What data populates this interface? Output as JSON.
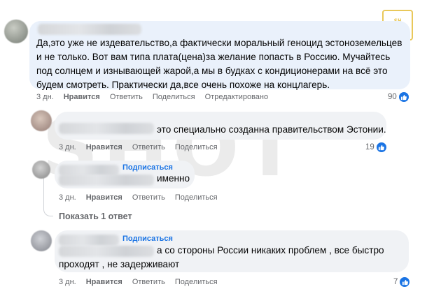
{
  "watermark": {
    "text": "SHOT",
    "logo_lines": [
      "SH",
      "OT"
    ]
  },
  "comments": [
    {
      "text": "Да,это уже не издевательство,а фактически моральный геноцид эстоноземельцев и не только. Вот вам типа плата(цена)за желание попасть в Россию. Мучайтесь под солнцем и изнывающей жарой,а мы в будках с кондиционерами на всё это будем смотреть. Практически да,все очень похоже на концлагерь.",
      "time": "3 дн.",
      "like": "Нравится",
      "reply": "Ответить",
      "share": "Поделиться",
      "edited": "Отредактировано",
      "reactions": "90"
    },
    {
      "text": "это специально созданна правительством Эстонии.",
      "time": "3 дн.",
      "like": "Нравится",
      "reply": "Ответить",
      "share": "Поделиться",
      "reactions": "19"
    },
    {
      "follow": "Подписаться",
      "text": "именно",
      "time": "3 дн.",
      "like": "Нравится",
      "reply": "Ответить",
      "share": "Поделиться"
    },
    {
      "follow": "Подписаться",
      "text_line1": "а со стороны России никаких проблем , все быстро",
      "text_line2": "проходят , не задерживают",
      "time": "3 дн.",
      "like": "Нравится",
      "reply": "Ответить",
      "share": "Поделиться",
      "reactions": "7"
    }
  ],
  "show_replies": "Показать 1 ответ",
  "icons": {
    "reaction": "like-icon"
  },
  "colors": {
    "accent": "#1b74e4",
    "bubble": "#f0f2f5",
    "muted": "#65676b"
  }
}
